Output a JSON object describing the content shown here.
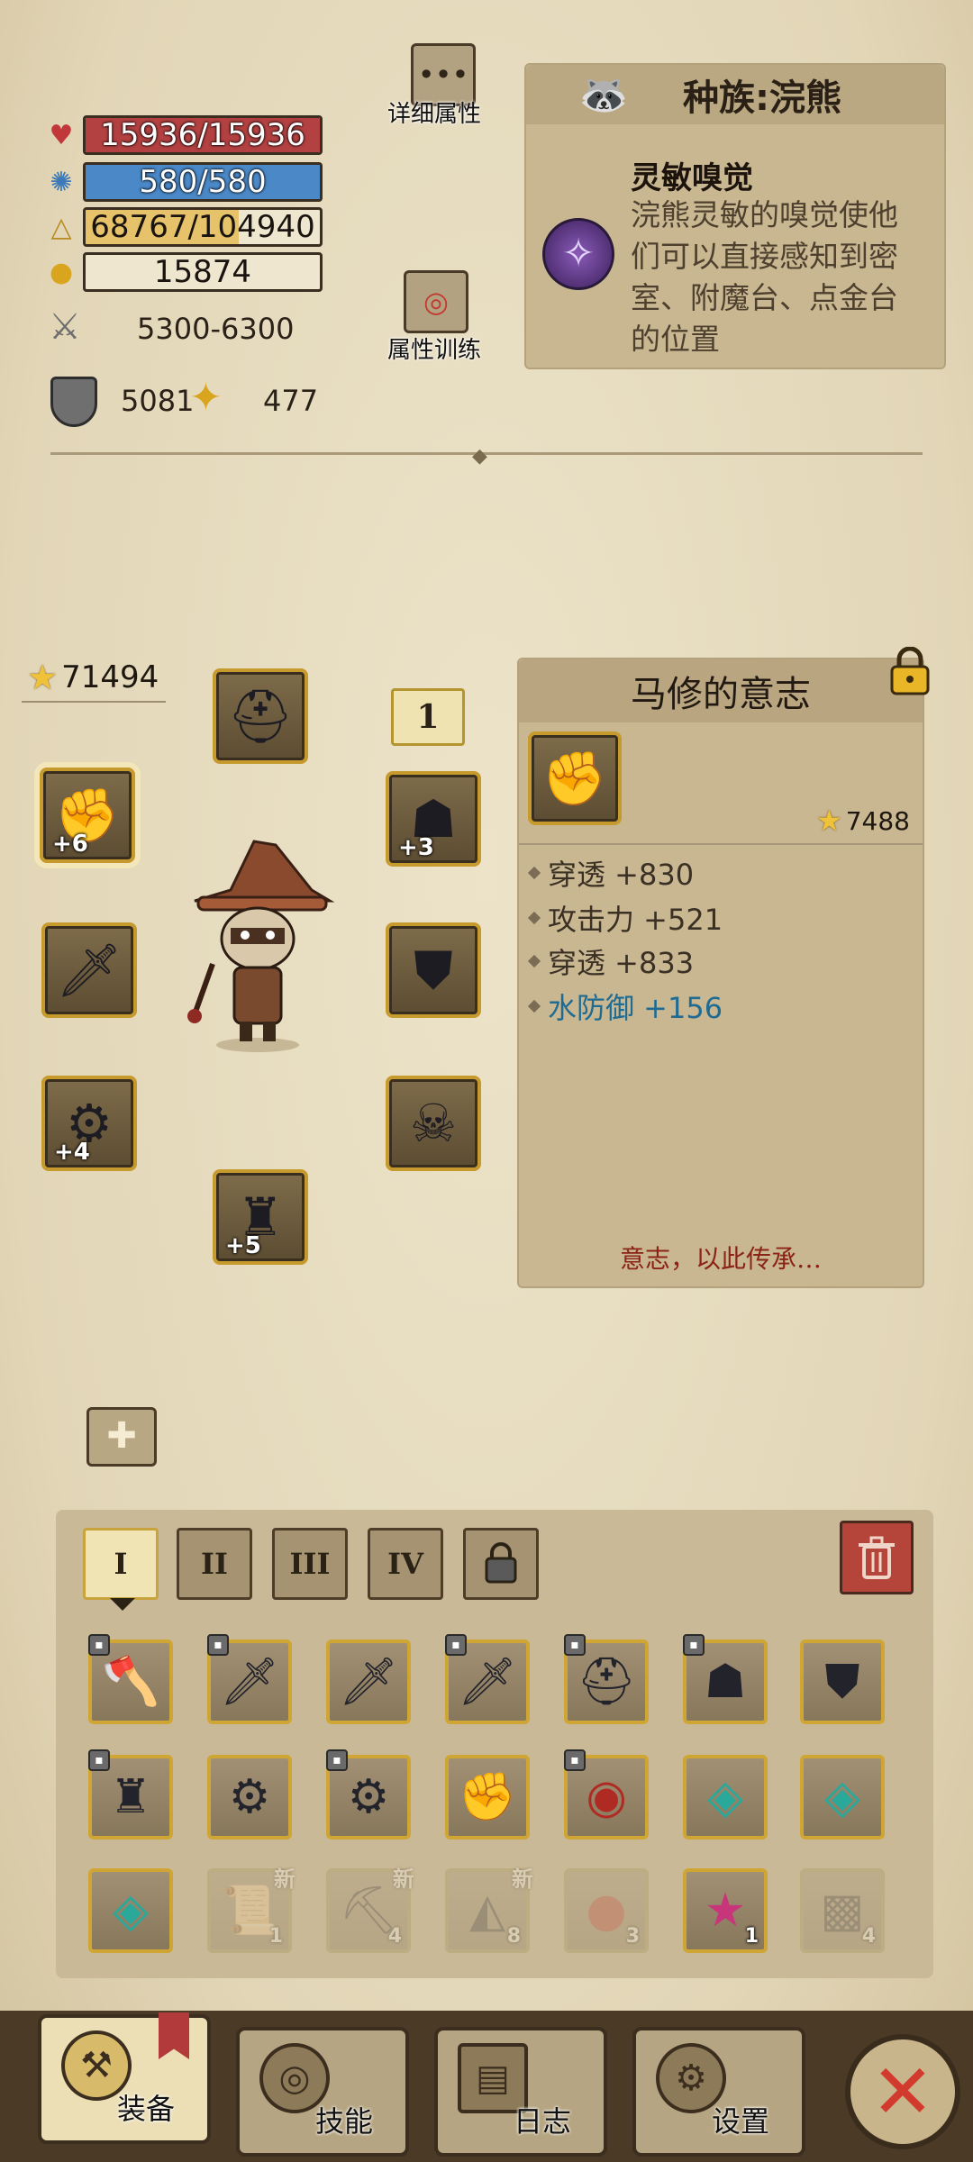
{
  "stats": {
    "hp": "15936/15936",
    "mp": "580/580",
    "exp": "68767/104940",
    "gold": "15874",
    "attack": "5300-6300",
    "defense": "5081",
    "luck": "477",
    "hp_ratio": 1.0,
    "mp_ratio": 1.0,
    "exp_ratio": 0.655
  },
  "buttons": {
    "details": "详细属性",
    "training": "属性训练"
  },
  "race": {
    "title": "种族:浣熊",
    "skill_name": "灵敏嗅觉",
    "skill_desc_1": "浣熊灵敏的嗅觉使他",
    "skill_desc_2": "们可以直接感知到密",
    "skill_desc_3": "室、附魔台、点金台",
    "skill_desc_4": "的位置"
  },
  "equipment": {
    "total_score": "71494",
    "set_index": "1",
    "plus_gauntlet": "+6",
    "plus_shoulder_r": "+3",
    "plus_bracer": "+4",
    "plus_boots": "+5"
  },
  "item": {
    "name": "马修的意志",
    "score": "7488",
    "attrs": [
      "穿透 +830",
      "攻击力 +521",
      "穿透 +833",
      "水防御 +156"
    ],
    "quote": "意志，以此传承…"
  },
  "tabs": [
    "I",
    "II",
    "III",
    "IV"
  ],
  "inventory": {
    "counts": [
      "1",
      "4",
      "8",
      "3",
      "1",
      "4"
    ],
    "new_badge": "新"
  },
  "nav": {
    "equip": "装备",
    "skills": "技能",
    "log": "日志",
    "settings": "设置"
  },
  "colors": {
    "hp": "#b34141",
    "mp": "#4a88c7",
    "exp": "#e6c36a",
    "accent_gold": "#c79a2e",
    "water_text": "#1f6b92",
    "close_red": "#d23a2d"
  }
}
